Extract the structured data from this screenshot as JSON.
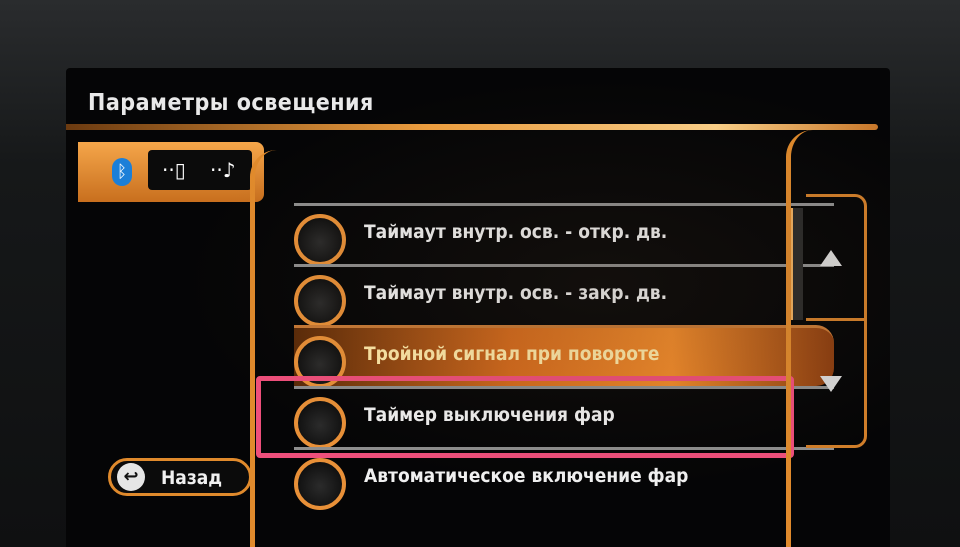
{
  "screen": {
    "title": "Параметры освещения"
  },
  "device_bar": {
    "bluetooth_icon": "bluetooth-icon",
    "phone_icon": "phone-icon",
    "music_icon": "music-icon",
    "bluetooth_glyph": "ᛒ",
    "phone_glyph": "··▯",
    "music_glyph": "··♪"
  },
  "menu": {
    "items": [
      {
        "label": "Таймаут внутр. осв. - откр. дв.",
        "state": "off"
      },
      {
        "label": "Таймаут внутр. осв. - закр. дв.",
        "state": "off"
      },
      {
        "label": "Тройной сигнал при повороте",
        "state": "off",
        "active": true
      },
      {
        "label": "Таймер выключения фар",
        "state": "off",
        "highlighted": true
      },
      {
        "label": "Автоматическое включение фар",
        "state": "off"
      }
    ]
  },
  "navigation": {
    "up_icon": "arrow-up-icon",
    "down_icon": "arrow-down-icon"
  },
  "back_button": {
    "label": "Назад",
    "icon": "back-arrow-icon",
    "glyph": "↩"
  },
  "colors": {
    "accent": "#e08a2c",
    "highlight_frame": "#ee4f7b",
    "bluetooth": "#1c7fd8"
  }
}
